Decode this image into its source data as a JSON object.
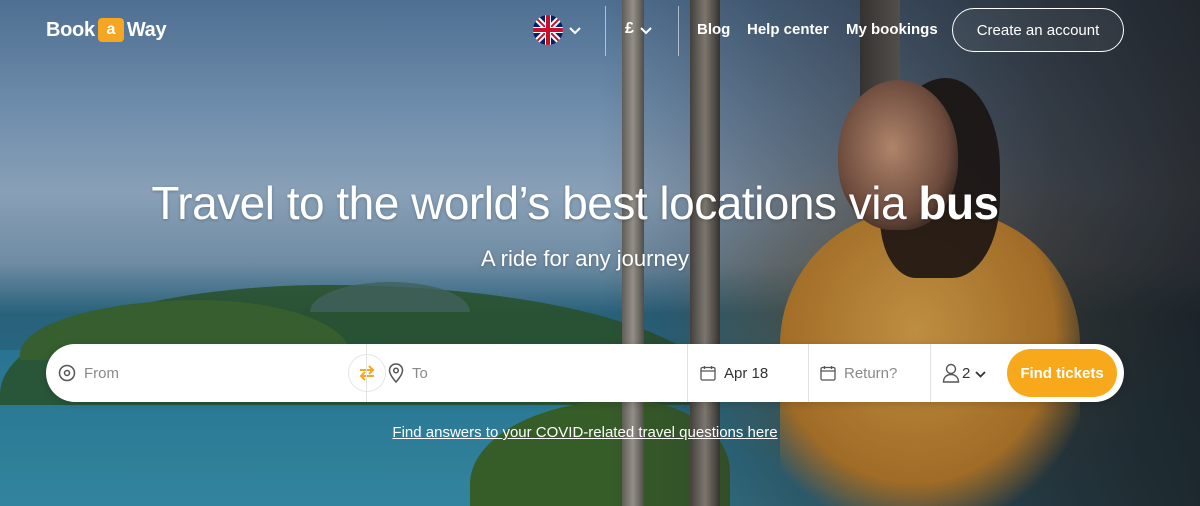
{
  "header": {
    "logo": {
      "left": "Book",
      "mid": "a",
      "right": "Way"
    },
    "language_icon": "uk-flag-icon",
    "currency_symbol": "£",
    "nav": [
      "Blog",
      "Help center",
      "My bookings"
    ],
    "create_account": "Create an account"
  },
  "hero": {
    "headline_main": "Travel to the world’s best locations via ",
    "headline_bold": "bus",
    "subheadline": "A ride for any journey"
  },
  "search": {
    "from_placeholder": "From",
    "to_placeholder": "To",
    "depart_date": "Apr 18",
    "return_placeholder": "Return?",
    "passengers": "2",
    "find_label": "Find tickets"
  },
  "covid_link": "Find answers to your COVID-related travel questions here",
  "colors": {
    "accent": "#f7a81b",
    "white": "#ffffff"
  }
}
